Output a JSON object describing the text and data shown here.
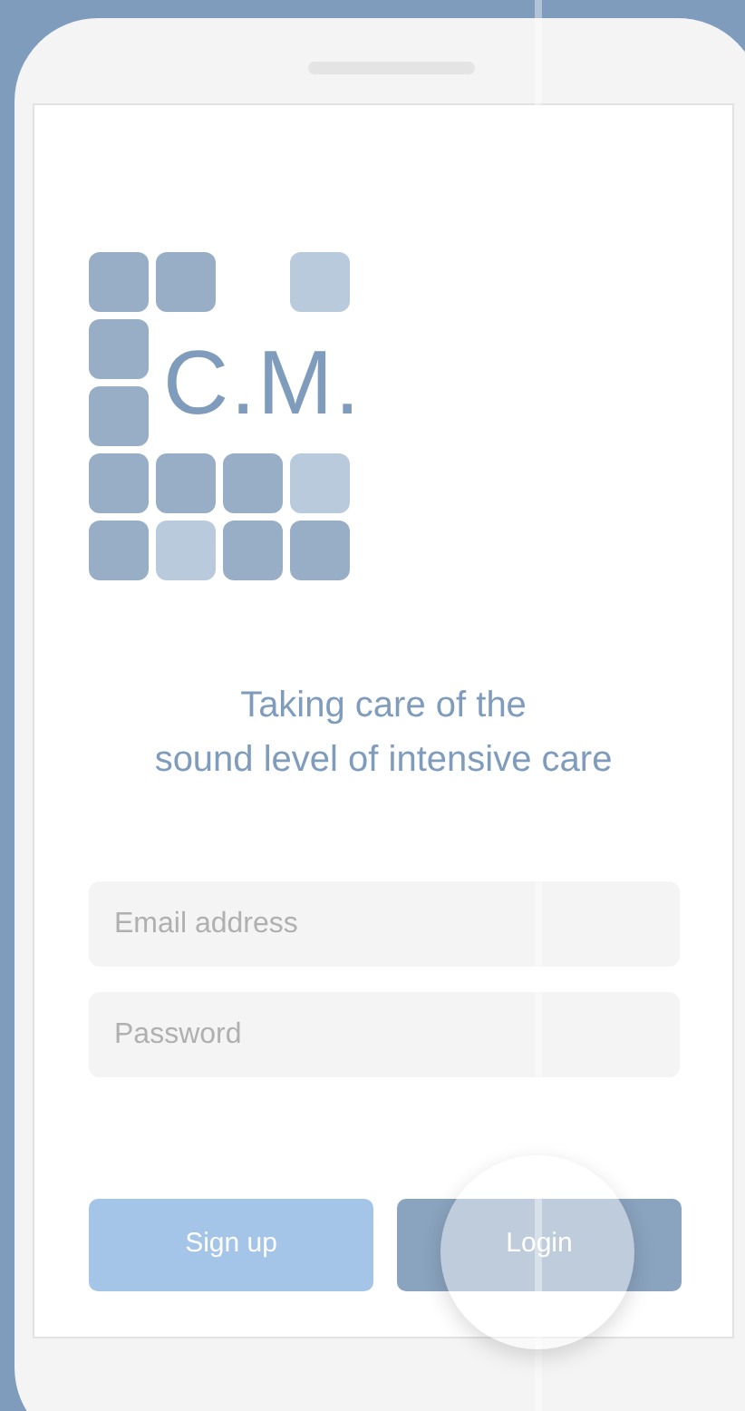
{
  "logo": {
    "text": "C.M."
  },
  "tagline": [
    "Taking care of the",
    "sound level of intensive care"
  ],
  "email_field": {
    "placeholder": "Email address"
  },
  "password_field": {
    "placeholder": "Password"
  },
  "buttons": [
    {
      "label": "Sign up",
      "kind": "secondary"
    },
    {
      "label": "Login",
      "kind": "primary"
    }
  ]
}
